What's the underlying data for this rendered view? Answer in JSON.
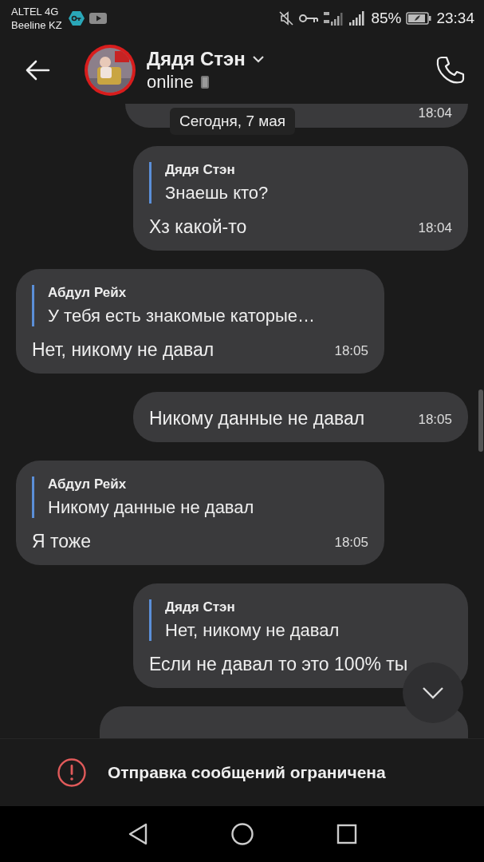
{
  "status_bar": {
    "carrier_1": "ALTEL 4G",
    "carrier_2": "Beeline KZ",
    "battery": "85%",
    "time": "23:34"
  },
  "header": {
    "name": "Дядя Стэн",
    "status": "online"
  },
  "date_chip": "Сегодня, 7 мая",
  "messages": [
    {
      "kind": "out",
      "time": "18:04",
      "cut_top": true
    },
    {
      "kind": "out",
      "reply": {
        "author": "Дядя Стэн",
        "text": "Знаешь кто?"
      },
      "text": "Хз какой-то",
      "time": "18:04"
    },
    {
      "kind": "in",
      "reply": {
        "author": "Абдул Рейх",
        "text": "У тебя есть знакомые каторые…"
      },
      "text": "Нет, никому не давал",
      "time": "18:05"
    },
    {
      "kind": "out",
      "text": "Никому данные не давал",
      "time": "18:05"
    },
    {
      "kind": "in",
      "reply": {
        "author": "Абдул Рейх",
        "text": "Никому данные не давал"
      },
      "text": "Я тоже",
      "time": "18:05"
    },
    {
      "kind": "out",
      "reply": {
        "author": "Дядя Стэн",
        "text": "Нет, никому не давал"
      },
      "text": "Если не давал то это 100% ты"
    },
    {
      "kind": "out",
      "cut_bottom": true
    }
  ],
  "notice": "Отправка сообщений ограничена"
}
